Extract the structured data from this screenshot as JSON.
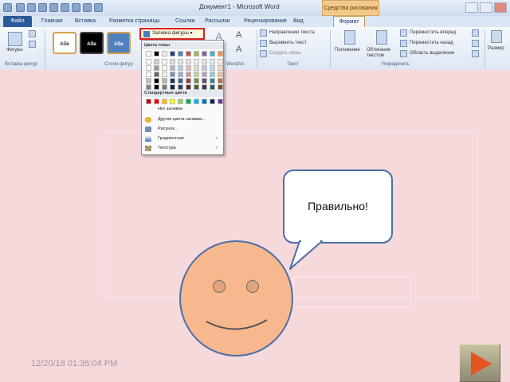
{
  "window": {
    "title": "Документ1 - Microsoft Word",
    "context_tab_title": "Средства рисования"
  },
  "tabs": [
    "Файл",
    "Главная",
    "Вставка",
    "Разметка страницы",
    "Ссылки",
    "Рассылки",
    "Рецензирование",
    "Вид",
    "Формат"
  ],
  "ribbon": {
    "shapes_label": "Фигуры",
    "group_insert_shapes": "Вставка фигур",
    "style_sample": "Абв",
    "group_shape_styles": "Стили фигур",
    "wordart_label": "WordArt",
    "text_direction": "Направление текста",
    "align_text": "Выровнять текст",
    "create_link": "Создать связь",
    "group_text": "Текст",
    "position": "Положение",
    "wrap_text": "Обтекание текстом",
    "bring_forward": "Переместить вперед",
    "send_backward": "Переместить назад",
    "selection_pane": "Область выделения",
    "group_arrange": "Упорядочить",
    "size": "Размер"
  },
  "fill_dropdown": {
    "button_label": "Заливка фигуры",
    "theme_colors_header": "Цвета темы",
    "standard_colors_header": "Стандартные цвета",
    "no_fill": "Нет заливки",
    "more_colors": "Другие цвета заливки...",
    "picture": "Рисунок...",
    "gradient": "Градиентная",
    "texture": "Текстура",
    "theme_colors": [
      "#ffffff",
      "#000000",
      "#eeece1",
      "#1f497d",
      "#4f81bd",
      "#c0504d",
      "#9bbb59",
      "#8064a2",
      "#4bacc6",
      "#f79646"
    ],
    "standard_colors": [
      "#c00000",
      "#ff0000",
      "#ffc000",
      "#ffff00",
      "#92d050",
      "#00b050",
      "#00b0f0",
      "#0070c0",
      "#002060",
      "#7030a0"
    ]
  },
  "callout": {
    "text": "Правильно!"
  },
  "footer": {
    "date": "12/20/18 01:35:04 PM"
  },
  "colors": {
    "slide_background": "#f6d9db",
    "face_fill": "#f8b88e",
    "outline": "#4a6ea8",
    "next_arrow": "#e4541e"
  }
}
